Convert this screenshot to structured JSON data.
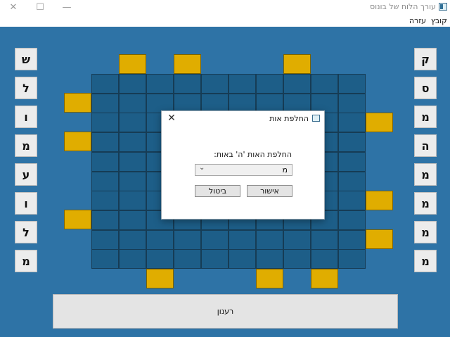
{
  "window": {
    "title": "עורך הלוח של בונוס",
    "icon": "window-app-icon",
    "controls": {
      "close": "✕",
      "maximize": "☐",
      "minimize": "—"
    }
  },
  "menu": {
    "file": "קובץ",
    "help": "עזרה"
  },
  "left_letters": [
    "ש",
    "ל",
    "ו",
    "מ",
    "ע",
    "ו",
    "ל",
    "מ"
  ],
  "right_letters": [
    "ק",
    "ס",
    "מ",
    "ה",
    "מ",
    "מ",
    "מ",
    "מ"
  ],
  "grid": {
    "rows": 10,
    "cols": 10
  },
  "refresh_label": "רענון",
  "dialog": {
    "title": "החלפת אות",
    "close": "✕",
    "prompt": "החלפת האות 'ה' באות:",
    "selected_value": "מ",
    "ok_label": "אישור",
    "cancel_label": "ביטול"
  },
  "colors": {
    "board": "#2e73a6",
    "cell": "#1d5e88",
    "highlight": "#e0ad00"
  }
}
